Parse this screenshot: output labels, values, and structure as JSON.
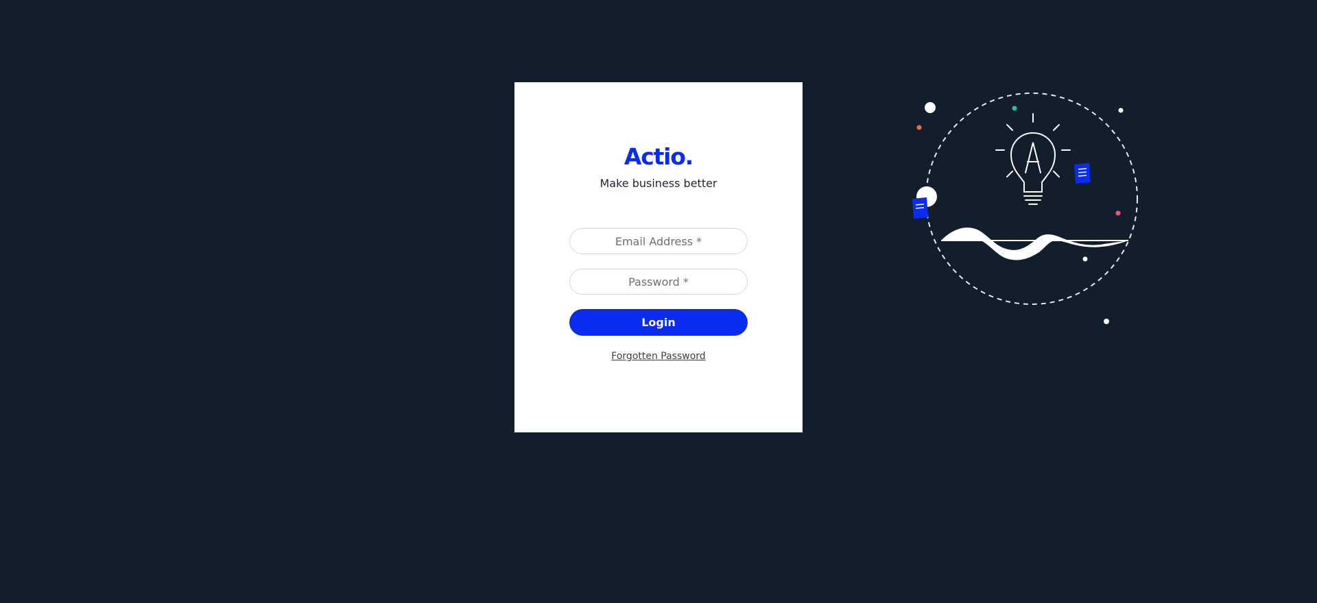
{
  "brand": {
    "name": "Actio.",
    "tagline": "Make business better",
    "accent_color": "#0a2bf0",
    "background_color": "#121e2b"
  },
  "login_form": {
    "email_placeholder": "Email Address *",
    "password_placeholder": "Password *",
    "login_label": "Login",
    "forgot_label": "Forgotten Password"
  },
  "illustration": {
    "icon": "lightbulb-icon",
    "bulb_letter": "A",
    "document_icon": "document-icon"
  }
}
